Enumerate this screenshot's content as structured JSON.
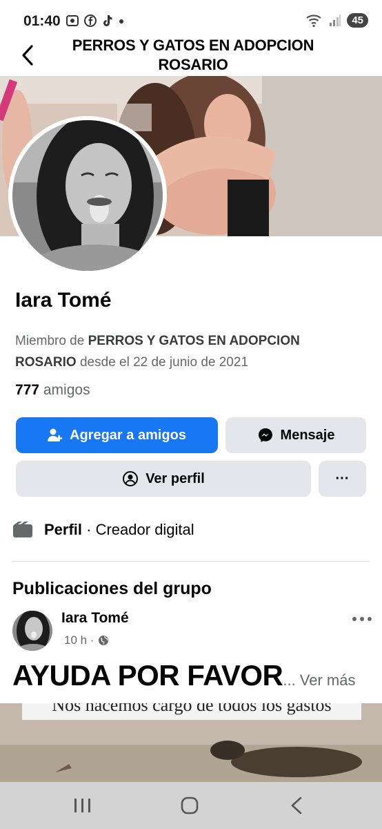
{
  "status_bar": {
    "time": "01:40",
    "battery": "45"
  },
  "header": {
    "title": "PERROS Y GATOS EN ADOPCION ROSARIO"
  },
  "profile": {
    "name": "Iara Tomé",
    "member_prefix": "Miembro de ",
    "member_group": "PERROS Y GATOS EN ADOPCION ROSARIO",
    "member_suffix": " desde el 22 de junio de 2021",
    "friends_count": "777",
    "friends_label": " amigos"
  },
  "buttons": {
    "add_friend": "Agregar a amigos",
    "message": "Mensaje",
    "view_profile": "Ver perfil",
    "more": "···"
  },
  "perfil_row": {
    "label": "Perfil",
    "separator": " · ",
    "category": "Creador digital"
  },
  "section": {
    "title": "Publicaciones del grupo"
  },
  "post": {
    "author": "Iara Tomé",
    "time": "10 h ·",
    "text": "AYUDA POR FAVOR",
    "see_more": "... Ver más",
    "image_caption": "Nos hacemos cargo de todos los gastos"
  },
  "colors": {
    "accent": "#1877f2",
    "secondary_button": "#e4e6eb",
    "muted_text": "#65676b"
  }
}
